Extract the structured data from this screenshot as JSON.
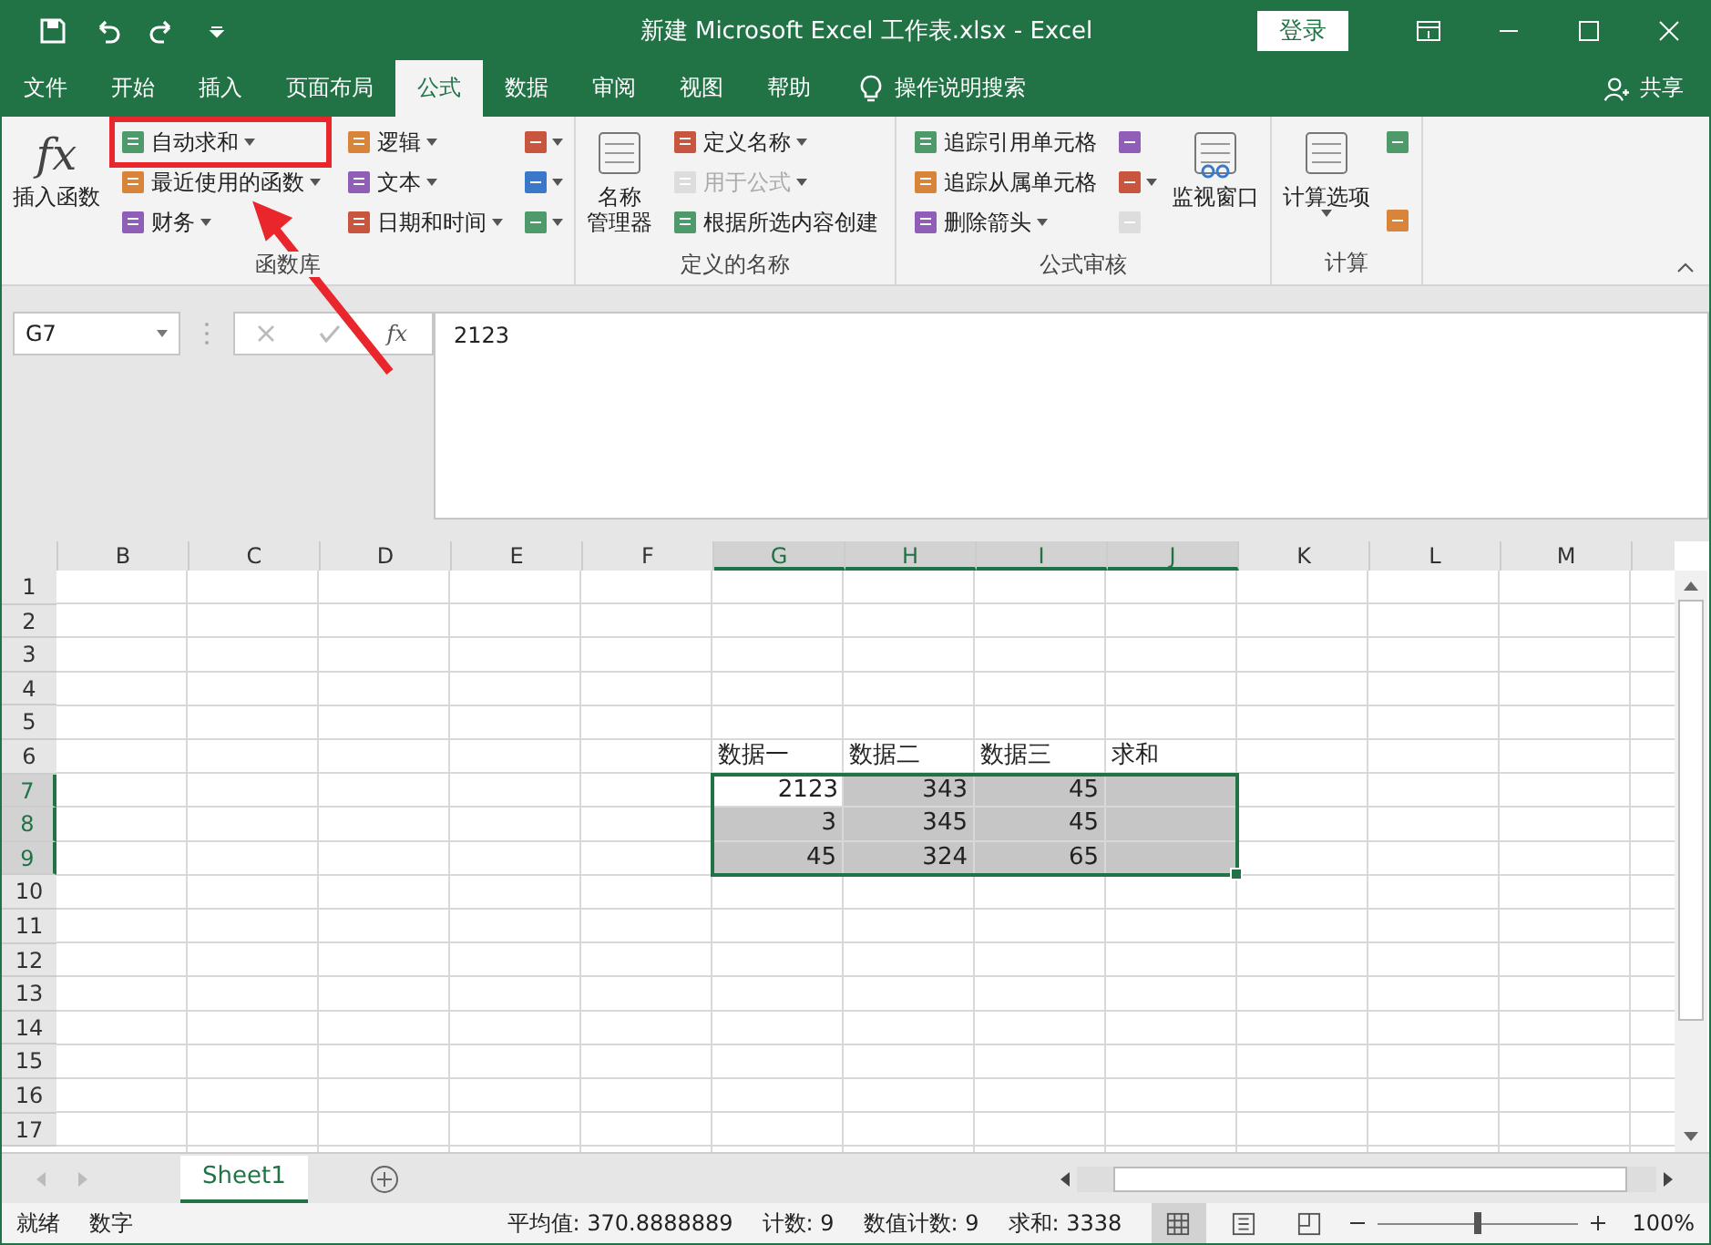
{
  "window": {
    "title": "新建 Microsoft Excel 工作表.xlsx  -  Excel",
    "login": "登录"
  },
  "tabs": [
    {
      "label": "文件",
      "selected": false
    },
    {
      "label": "开始",
      "selected": false
    },
    {
      "label": "插入",
      "selected": false
    },
    {
      "label": "页面布局",
      "selected": false
    },
    {
      "label": "公式",
      "selected": true
    },
    {
      "label": "数据",
      "selected": false
    },
    {
      "label": "审阅",
      "selected": false
    },
    {
      "label": "视图",
      "selected": false
    },
    {
      "label": "帮助",
      "selected": false
    }
  ],
  "tell_me": "操作说明搜索",
  "share": "共享",
  "ribbon": [
    {
      "name": "函数库",
      "columns": [
        [
          {
            "kind": "big",
            "glyph": "fx",
            "lines": [
              "插入函数"
            ]
          }
        ],
        [
          {
            "kind": "small",
            "label": "自动求和",
            "dropdown": true,
            "highlighted": true
          },
          {
            "kind": "small",
            "label": "最近使用的函数",
            "dropdown": true
          },
          {
            "kind": "small",
            "label": "财务",
            "dropdown": true
          }
        ],
        [
          {
            "kind": "small",
            "label": "逻辑",
            "dropdown": true
          },
          {
            "kind": "small",
            "label": "文本",
            "dropdown": true
          },
          {
            "kind": "small",
            "label": "日期和时间",
            "dropdown": true
          }
        ],
        [
          {
            "kind": "icon",
            "dropdown": true
          },
          {
            "kind": "icon",
            "dropdown": true
          },
          {
            "kind": "icon",
            "dropdown": true
          }
        ]
      ]
    },
    {
      "name": "定义的名称",
      "columns": [
        [
          {
            "kind": "big",
            "lines": [
              "名称",
              "管理器"
            ]
          }
        ],
        [
          {
            "kind": "small",
            "label": "定义名称",
            "dropdown": true
          },
          {
            "kind": "small",
            "label": "用于公式",
            "dropdown": true,
            "disabled": true
          },
          {
            "kind": "small",
            "label": "根据所选内容创建"
          }
        ]
      ]
    },
    {
      "name": "公式审核",
      "columns": [
        [
          {
            "kind": "small",
            "label": "追踪引用单元格"
          },
          {
            "kind": "small",
            "label": "追踪从属单元格"
          },
          {
            "kind": "small",
            "label": "删除箭头",
            "dropdown": true
          }
        ],
        [
          {
            "kind": "icon"
          },
          {
            "kind": "icon",
            "dropdown": true
          },
          {
            "kind": "icon",
            "disabled": true
          }
        ],
        [
          {
            "kind": "big",
            "lines": [
              "监视窗口"
            ]
          }
        ]
      ]
    },
    {
      "name": "计算",
      "columns": [
        [
          {
            "kind": "big",
            "lines": [
              "计算选项"
            ],
            "dropdown": true
          }
        ],
        [
          {
            "kind": "icon"
          },
          {
            "kind": "icon"
          }
        ]
      ]
    }
  ],
  "formula_bar": {
    "name_box": "G7",
    "fx": "fx",
    "value": "2123"
  },
  "sheet": {
    "columns": [
      {
        "label": "B",
        "selected": false
      },
      {
        "label": "C",
        "selected": false
      },
      {
        "label": "D",
        "selected": false
      },
      {
        "label": "E",
        "selected": false
      },
      {
        "label": "F",
        "selected": false
      },
      {
        "label": "G",
        "selected": true
      },
      {
        "label": "H",
        "selected": true
      },
      {
        "label": "I",
        "selected": true
      },
      {
        "label": "J",
        "selected": true
      },
      {
        "label": "K",
        "selected": false
      },
      {
        "label": "L",
        "selected": false
      },
      {
        "label": "M",
        "selected": false
      }
    ],
    "rows": [
      {
        "label": "1",
        "selected": false
      },
      {
        "label": "2",
        "selected": false
      },
      {
        "label": "3",
        "selected": false
      },
      {
        "label": "4",
        "selected": false
      },
      {
        "label": "5",
        "selected": false
      },
      {
        "label": "6",
        "selected": false,
        "cells": [
          {},
          {},
          {},
          {},
          {},
          {
            "kind": "text",
            "text": "数据一"
          },
          {
            "kind": "text",
            "text": "数据二"
          },
          {
            "kind": "text",
            "text": "数据三"
          },
          {
            "kind": "text",
            "text": "求和"
          },
          {},
          {},
          {}
        ]
      },
      {
        "label": "7",
        "selected": true,
        "cells": [
          {},
          {},
          {},
          {},
          {},
          {
            "kind": "number",
            "text": "2123",
            "selected": true,
            "active": true
          },
          {
            "kind": "number",
            "text": "343",
            "selected": true
          },
          {
            "kind": "number",
            "text": "45",
            "selected": true
          },
          {
            "selected": true
          },
          {},
          {},
          {}
        ]
      },
      {
        "label": "8",
        "selected": true,
        "cells": [
          {},
          {},
          {},
          {},
          {},
          {
            "kind": "number",
            "text": "3",
            "selected": true
          },
          {
            "kind": "number",
            "text": "345",
            "selected": true
          },
          {
            "kind": "number",
            "text": "45",
            "selected": true
          },
          {
            "selected": true
          },
          {},
          {},
          {}
        ]
      },
      {
        "label": "9",
        "selected": true,
        "cells": [
          {},
          {},
          {},
          {},
          {},
          {
            "kind": "number",
            "text": "45",
            "selected": true
          },
          {
            "kind": "number",
            "text": "324",
            "selected": true
          },
          {
            "kind": "number",
            "text": "65",
            "selected": true
          },
          {
            "selected": true
          },
          {},
          {},
          {}
        ]
      },
      {
        "label": "10",
        "selected": false
      },
      {
        "label": "11",
        "selected": false
      },
      {
        "label": "12",
        "selected": false
      },
      {
        "label": "13",
        "selected": false
      },
      {
        "label": "14",
        "selected": false
      },
      {
        "label": "15",
        "selected": false
      },
      {
        "label": "16",
        "selected": false
      },
      {
        "label": "17",
        "selected": false
      }
    ]
  },
  "sheet_tabs": [
    {
      "label": "Sheet1",
      "selected": true
    }
  ],
  "status_bar": {
    "left": [
      "就绪",
      "数字"
    ],
    "stats": [
      "平均值: 370.8888889",
      "计数: 9",
      "数值计数: 9",
      "求和: 3338"
    ],
    "views": [
      {
        "selected": true
      },
      {
        "selected": false
      },
      {
        "selected": false
      }
    ],
    "zoom": {
      "level": 0.5,
      "reading": "100%"
    }
  }
}
